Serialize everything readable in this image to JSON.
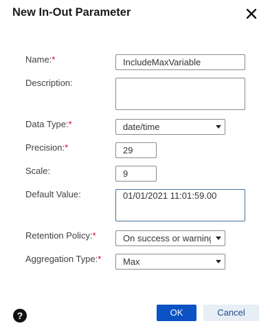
{
  "dialog": {
    "title": "New In-Out Parameter",
    "close_icon": "close-icon",
    "help_icon": "help-icon",
    "help_glyph": "?",
    "required_marker": "*"
  },
  "fields": {
    "name": {
      "label": "Name:",
      "value": "IncludeMaxVariable"
    },
    "description": {
      "label": "Description:",
      "value": ""
    },
    "data_type": {
      "label": "Data Type:",
      "value": "date/time"
    },
    "precision": {
      "label": "Precision:",
      "value": "29"
    },
    "scale": {
      "label": "Scale:",
      "value": "9"
    },
    "default_value": {
      "label": "Default Value:",
      "value": "01/01/2021 11:01:59.00"
    },
    "retention_policy": {
      "label": "Retention Policy:",
      "value": "On success or warning"
    },
    "aggregation_type": {
      "label": "Aggregation Type:",
      "value": "Max"
    }
  },
  "buttons": {
    "ok": "OK",
    "cancel": "Cancel"
  },
  "colors": {
    "primary": "#0b52c4",
    "secondary": "#e8eef5",
    "required": "#d0021b"
  }
}
